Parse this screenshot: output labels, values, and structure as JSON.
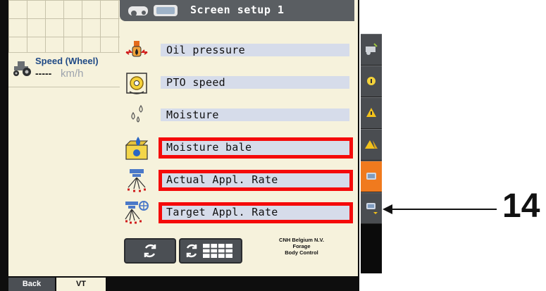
{
  "header": {
    "title": "Screen setup 1"
  },
  "speed_widget": {
    "label": "Speed (Wheel)",
    "value": "-----",
    "unit": "km/h"
  },
  "parameters": [
    {
      "label": "Oil pressure",
      "icon": "oil-pressure-icon",
      "highlighted": false
    },
    {
      "label": "PTO speed",
      "icon": "pto-speed-icon",
      "highlighted": false
    },
    {
      "label": "Moisture",
      "icon": "moisture-drops-icon",
      "highlighted": false
    },
    {
      "label": "Moisture bale",
      "icon": "moisture-bale-icon",
      "highlighted": true
    },
    {
      "label": "Actual Appl. Rate",
      "icon": "actual-rate-icon",
      "highlighted": true
    },
    {
      "label": "Target Appl. Rate",
      "icon": "target-rate-icon",
      "highlighted": true
    }
  ],
  "company": {
    "line1": "CNH Belgium N.V.",
    "line2": "Forage",
    "line3": "Body Control"
  },
  "tabs": {
    "back": "Back",
    "vt": "VT"
  },
  "annotation": {
    "number": "14"
  },
  "colors": {
    "panel": "#f6f2dc",
    "header": "#5a5e62",
    "highlight": "#f50a0a",
    "active_tool": "#f07a1e"
  }
}
